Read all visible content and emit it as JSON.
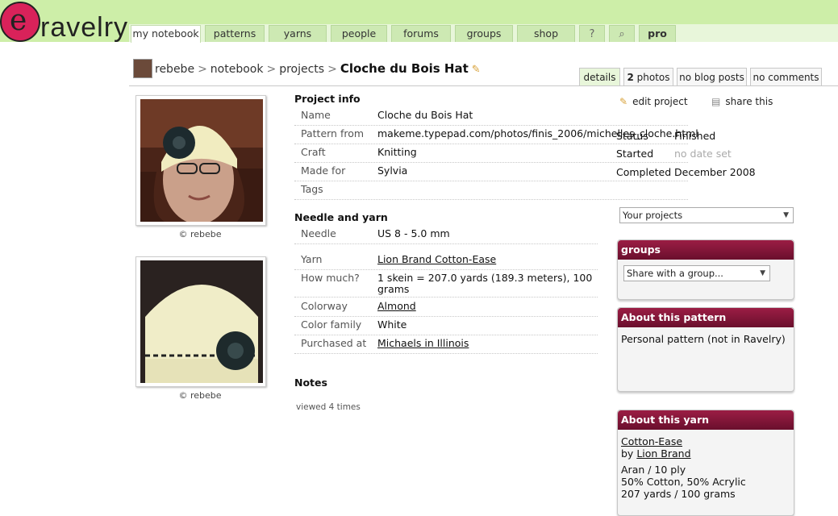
{
  "brand": {
    "logo_letter": "e",
    "logo_text": "ravelry"
  },
  "nav": {
    "tabs": [
      "my notebook",
      "patterns",
      "yarns",
      "people",
      "forums",
      "groups",
      "shop",
      "?",
      "⌕",
      "pro"
    ]
  },
  "breadcrumb": {
    "user": "rebebe",
    "sep": ">",
    "notebook": "notebook",
    "projects": "projects",
    "title": "Cloche du Bois Hat",
    "edit_icon": "pencil-icon"
  },
  "page_tabs": {
    "details": "details",
    "photos_count": "2",
    "photos": "photos",
    "blog": "no blog posts",
    "comments": "no comments"
  },
  "photos": [
    {
      "caption": "© rebebe"
    },
    {
      "caption": "© rebebe"
    }
  ],
  "project_info": {
    "title": "Project info",
    "rows": [
      {
        "label": "Name",
        "value": "Cloche du Bois Hat"
      },
      {
        "label": "Pattern from",
        "value": "makeme.typepad.com/photos/finis_2006/michelles_cloche.html"
      },
      {
        "label": "Craft",
        "value": "Knitting"
      },
      {
        "label": "Made for",
        "value": "Sylvia"
      },
      {
        "label": "Tags",
        "value": ""
      }
    ]
  },
  "actions": {
    "edit": "edit project",
    "share": "share this"
  },
  "status": {
    "status_label": "Status",
    "status_value": "Finished",
    "started_label": "Started",
    "started_value": "no date set",
    "completed_label": "Completed",
    "completed_value": "December 2008"
  },
  "needle_yarn": {
    "title": "Needle and yarn",
    "needle_label": "Needle",
    "needle_value": "US 8 - 5.0 mm",
    "yarn_label": "Yarn",
    "yarn_value": "Lion Brand Cotton-Ease",
    "howmuch_label": "How much?",
    "howmuch_line1": "1 skein = 207.0 yards (189.3 meters), 100",
    "howmuch_line2": "grams",
    "colorway_label": "Colorway",
    "colorway_value": "Almond",
    "colorfamily_label": "Color family",
    "colorfamily_value": "White",
    "purchased_label": "Purchased at",
    "purchased_value": "Michaels in Illinois"
  },
  "notes": {
    "title": "Notes",
    "views": "viewed 4 times"
  },
  "sidebar": {
    "projects_select": "Your projects",
    "groups": {
      "title": "groups",
      "select": "Share with a group..."
    },
    "pattern": {
      "title": "About this pattern",
      "text": "Personal pattern (not in Ravelry)"
    },
    "yarn": {
      "title": "About this yarn",
      "name": "Cotton-Ease",
      "by": "by ",
      "brand": "Lion Brand",
      "weight": "Aran / 10 ply",
      "fiber": "50% Cotton, 50% Acrylic",
      "yardage": "207 yards / 100 grams"
    }
  },
  "colors": {
    "topbar": "#cdeea8",
    "panel_header": "#8a1a3c",
    "logo": "#d9225a"
  }
}
